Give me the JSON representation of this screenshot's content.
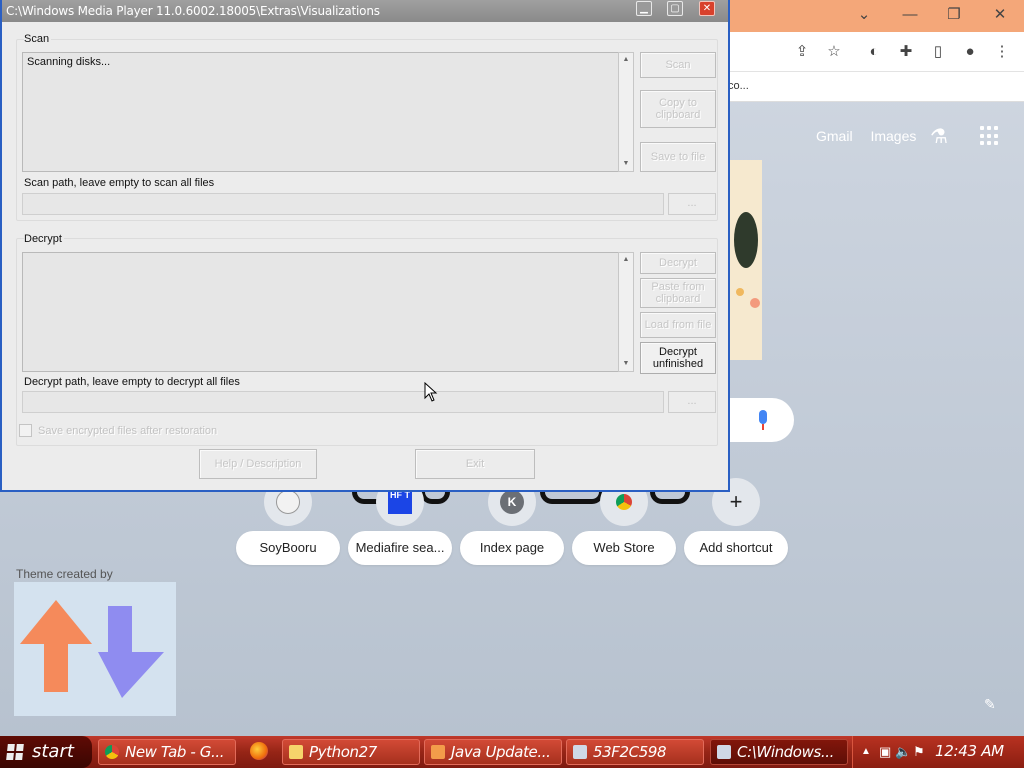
{
  "wmp": {
    "title": "C:\\Windows Media Player 11.0.6002.18005\\Extras\\Visualizations",
    "scan": {
      "group_label": "Scan",
      "log_text": "Scanning disks...",
      "btn_scan": "Scan",
      "btn_copy": "Copy to clipboard",
      "btn_save": "Save to file",
      "path_label": "Scan path, leave empty to scan all files",
      "path_value": "",
      "browse": "..."
    },
    "decrypt": {
      "group_label": "Decrypt",
      "log_text": "",
      "btn_decrypt": "Decrypt",
      "btn_paste": "Paste from clipboard",
      "btn_load": "Load from file",
      "btn_unfinished": "Decrypt unfinished",
      "path_label": "Decrypt path, leave empty to decrypt all files",
      "path_value": "",
      "browse": "..."
    },
    "checkbox_label": "Save encrypted files after restoration",
    "btn_help": "Help / Description",
    "btn_exit": "Exit"
  },
  "chrome": {
    "bookmark_fragment": "co...",
    "google_links": [
      "Gmail",
      "Images"
    ],
    "shortcuts": [
      {
        "label": "SoyBooru",
        "icon": "soyjak-icon"
      },
      {
        "label": "Mediafire sea...",
        "icon": "mediafire-icon",
        "glyph": "HF T"
      },
      {
        "label": "Index page",
        "icon": "k-icon",
        "glyph": "K"
      },
      {
        "label": "Web Store",
        "icon": "chrome-icon"
      },
      {
        "label": "Add shortcut",
        "icon": "plus-icon",
        "glyph": "+"
      }
    ],
    "theme_label": "Theme created by"
  },
  "taskbar": {
    "start": "start",
    "tasks": [
      {
        "label": "New Tab - G...",
        "icon": "chrome-icon"
      },
      {
        "label": "Python27",
        "icon": "folder-icon"
      },
      {
        "label": "Java Update...",
        "icon": "java-icon"
      },
      {
        "label": "53F2C598",
        "icon": "window-icon"
      },
      {
        "label": "C:\\Windows...",
        "icon": "window-icon"
      }
    ],
    "clock": "12:43 AM"
  }
}
